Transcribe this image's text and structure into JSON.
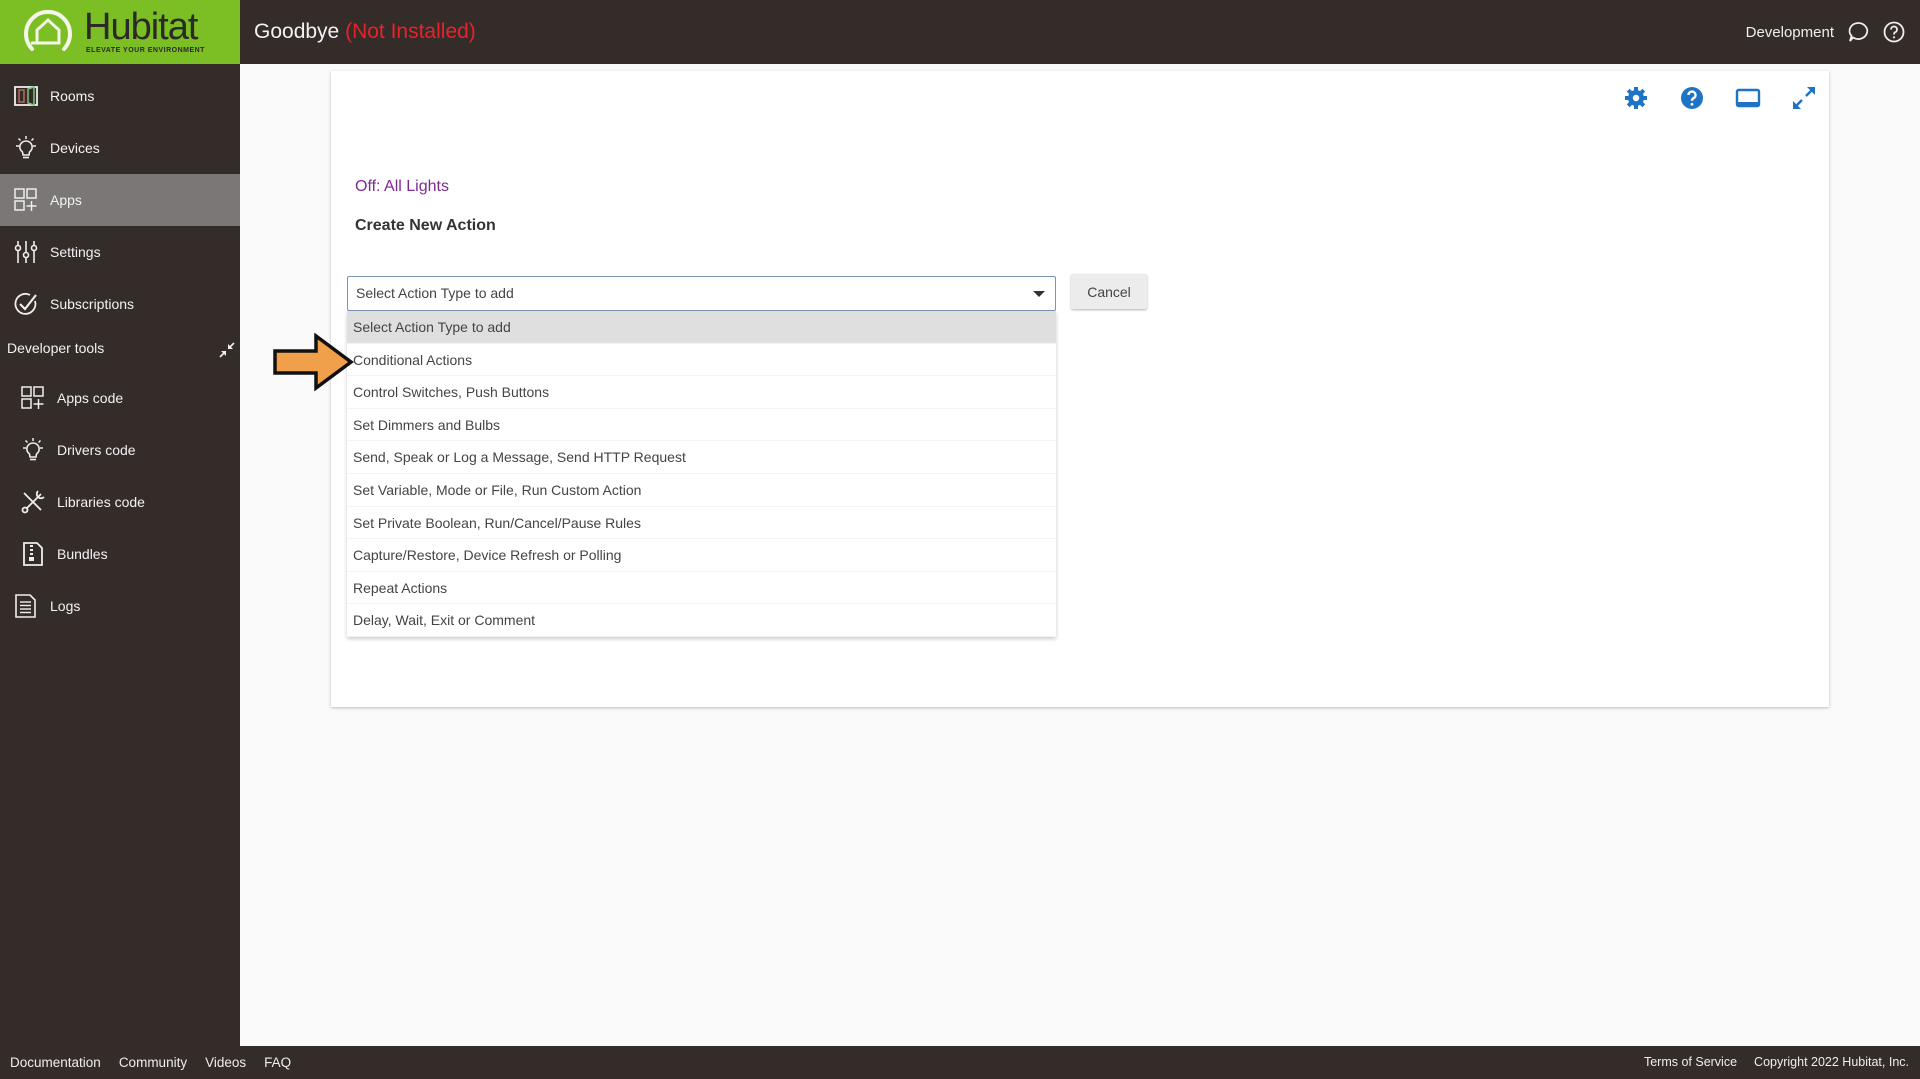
{
  "header": {
    "brand": "Hubitat",
    "tagline": "ELEVATE YOUR ENVIRONMENT",
    "app_name": "Goodbye",
    "app_status": "(Not Installed)",
    "hub_name": "Development",
    "icons": [
      "chat-bubble-icon",
      "help-circle-icon"
    ]
  },
  "sidebar": {
    "items": [
      {
        "label": "Rooms",
        "icon": "rooms-icon"
      },
      {
        "label": "Devices",
        "icon": "lightbulb-icon"
      },
      {
        "label": "Apps",
        "icon": "apps-grid-icon",
        "active": true
      },
      {
        "label": "Settings",
        "icon": "sliders-icon"
      },
      {
        "label": "Subscriptions",
        "icon": "check-circle-icon"
      }
    ],
    "developer_tools_label": "Developer tools",
    "developer_items": [
      {
        "label": "Apps code",
        "icon": "apps-grid-icon"
      },
      {
        "label": "Drivers code",
        "icon": "lightbulb-icon"
      },
      {
        "label": "Libraries code",
        "icon": "tools-icon"
      },
      {
        "label": "Bundles",
        "icon": "zip-file-icon"
      }
    ],
    "logs_label": "Logs"
  },
  "main": {
    "toolbar_icons": [
      "gear-icon",
      "help-icon",
      "display-icon",
      "expand-icon"
    ],
    "rule_line": "Off: All Lights",
    "section_title": "Create New Action",
    "select": {
      "value": "Select Action Type to add",
      "options": [
        "Select Action Type to add",
        "Conditional Actions",
        "Control Switches, Push Buttons",
        "Set Dimmers and Bulbs",
        "Send, Speak or Log a Message, Send HTTP Request",
        "Set Variable, Mode or File, Run Custom Action",
        "Set Private Boolean, Run/Cancel/Pause Rules",
        "Capture/Restore, Device Refresh or Polling",
        "Repeat Actions",
        "Delay, Wait, Exit or Comment"
      ],
      "highlighted_index": 0
    },
    "cancel_label": "Cancel"
  },
  "annotation": {
    "type": "arrow",
    "color": "#f0a04b",
    "points_to": "Conditional Actions"
  },
  "footer": {
    "links": [
      "Documentation",
      "Community",
      "Videos",
      "FAQ"
    ],
    "terms": "Terms of Service",
    "copyright": "Copyright 2022 Hubitat, Inc."
  },
  "colors": {
    "brand_green": "#7bbf24",
    "dark_bg": "#342c29",
    "status_red": "#e8222a",
    "accent_blue": "#1f73c4",
    "rule_purple": "#7d2a8f"
  }
}
